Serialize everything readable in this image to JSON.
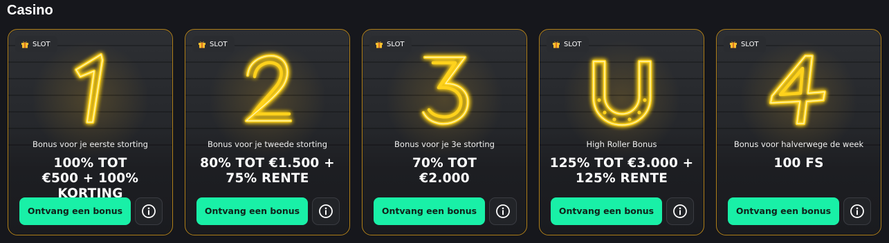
{
  "section": {
    "title": "Casino"
  },
  "colors": {
    "accent": "#19f0a7",
    "neon": "#ffd21a",
    "border": "#b0801c"
  },
  "cards": [
    {
      "badge": "SLOT",
      "icon": "neon-one-icon",
      "subtitle": "Bonus voor je eerste storting",
      "headline_lines": [
        "100% TOT",
        "€500 + 100%",
        "KORTING"
      ],
      "cta": "Ontvang een bonus"
    },
    {
      "badge": "SLOT",
      "icon": "neon-two-icon",
      "subtitle": "Bonus voor je tweede storting",
      "headline_lines": [
        "80% TOT €1.500 +",
        "75% RENTE"
      ],
      "cta": "Ontvang een bonus"
    },
    {
      "badge": "SLOT",
      "icon": "neon-three-icon",
      "subtitle": "Bonus voor je 3e storting",
      "headline_lines": [
        "70% TOT",
        "€2.000"
      ],
      "cta": "Ontvang een bonus"
    },
    {
      "badge": "SLOT",
      "icon": "neon-horseshoe-icon",
      "subtitle": "High Roller Bonus",
      "headline_lines": [
        "125% TOT €3.000 +",
        "125% RENTE"
      ],
      "cta": "Ontvang een bonus"
    },
    {
      "badge": "SLOT",
      "icon": "neon-four-icon",
      "subtitle": "Bonus voor halverwege de week",
      "headline_lines": [
        "100 FS"
      ],
      "cta": "Ontvang een bonus"
    }
  ]
}
